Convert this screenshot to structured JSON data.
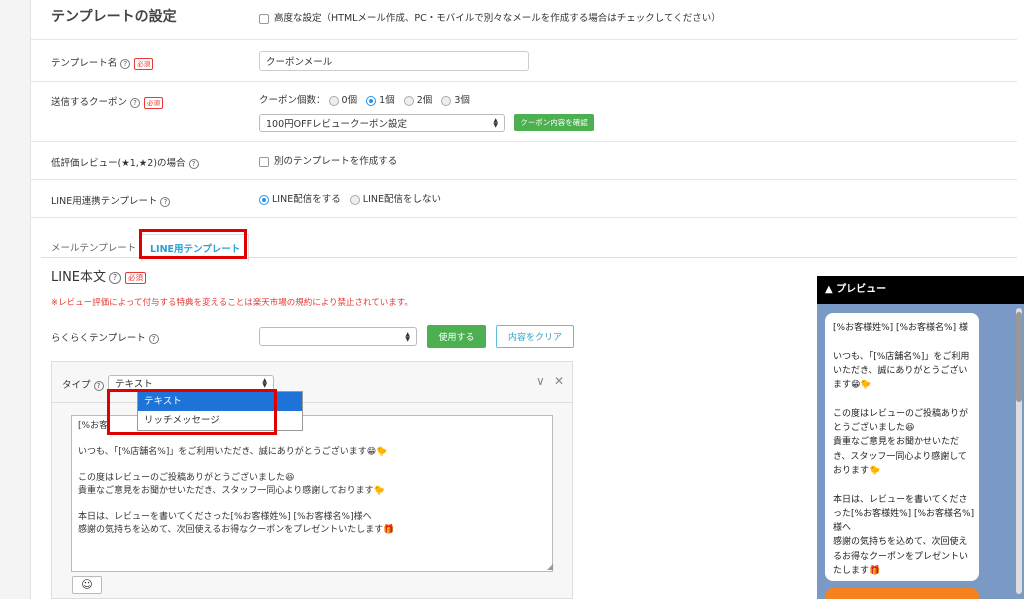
{
  "template_settings": {
    "title": "テンプレートの設定",
    "advanced_label": "高度な設定（HTMLメール作成、PC・モバイルで別々なメールを作成する場合はチェックしてください）"
  },
  "template_name": {
    "label": "テンプレート名",
    "required": "必須",
    "value": "クーポンメール"
  },
  "coupon": {
    "label": "送信するクーポン",
    "required": "必須",
    "count_label": "クーポン個数：",
    "options": [
      "0個",
      "1個",
      "2個",
      "3個"
    ],
    "selected_index": 1,
    "select_value": "100円OFFレビュークーポン設定",
    "confirm_button": "クーポン内容を確認"
  },
  "low_rating": {
    "label": "低評価レビュー(★1,★2)の場合",
    "checkbox_label": "別のテンプレートを作成する"
  },
  "line_template": {
    "label": "LINE用連携テンプレート",
    "options": [
      "LINE配信をする",
      "LINE配信をしない"
    ],
    "selected_index": 0
  },
  "tabs": [
    "メールテンプレート",
    "LINE用テンプレート"
  ],
  "line_body": {
    "heading": "LINE本文",
    "required": "必須",
    "warning": "※レビュー評価によって付与する特典を変えることは楽天市場の規約により禁止されています。",
    "easy_template_label": "らくらくテンプレート",
    "use_button": "使用する",
    "clear_button": "内容をクリア",
    "type_label": "タイプ",
    "type_value": "テキスト",
    "dropdown_options": [
      "テキスト",
      "リッチメッセージ"
    ],
    "message_prefix": "[%お客",
    "message_rest": "\n\nいつも、「[%店舗名%]」をご利用いただき、誠にありがとうございます😁🐤\n\nこの度はレビューのご投稿ありがとうございました😆\n貴重なご意見をお聞かせいただき、スタッフ一同心より感謝しております🐤\n\n本日は、レビューを書いてくださった[%お客様姓%] [%お客様名%]様へ\n感謝の気持ちを込めて、次回使えるお得なクーポンをプレゼントいたします🎁",
    "emoji_icon": "☺"
  },
  "preview": {
    "title": "▲ プレビュー",
    "text": "[%お客様姓%] [%お客様名%] 様\n\nいつも、「[%店舗名%]」をご利用\nいただき、誠にありがとうござい\nます😁🐤\n\nこの度はレビューのご投稿ありが\nとうございました😆\n貴重なご意見をお聞かせいただ\nき、スタッフ一同心より感謝して\nおります🐤\n\n本日は、レビューを書いてくださ\nった[%お客様姓%] [%お客様名%]\n様へ\n感謝の気持ちを込めて、次回使え\nるお得なクーポンをプレゼントい\nたします🎁"
  },
  "colors": {
    "accent_green": "#4caf50",
    "accent_blue": "#2196f3",
    "warning_red": "#e53935",
    "highlight_red": "#e00000",
    "preview_bg": "#7a99c4"
  }
}
